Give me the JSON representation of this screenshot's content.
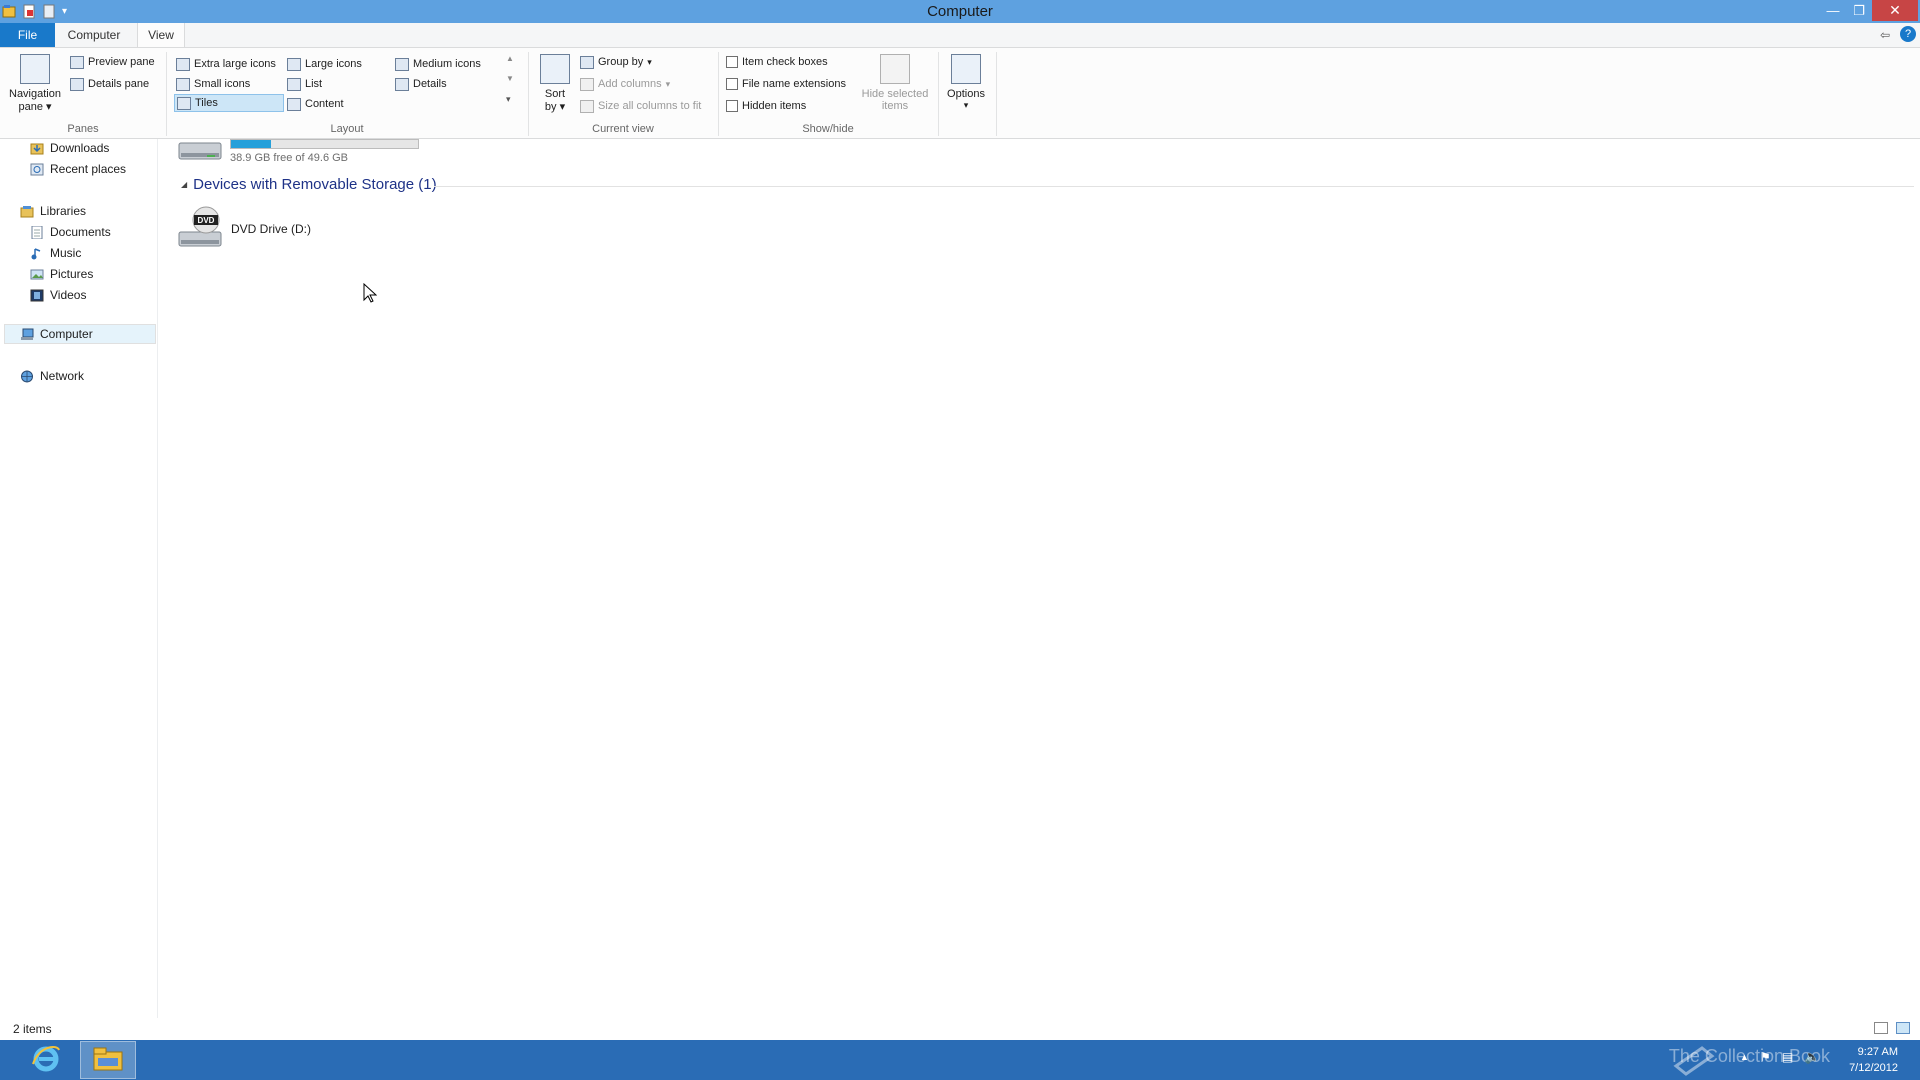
{
  "window": {
    "title": "Computer"
  },
  "ribbon": {
    "tabs": [
      {
        "label": "File"
      },
      {
        "label": "Computer"
      },
      {
        "label": "View"
      }
    ],
    "panes": {
      "navigation_pane": "Navigation",
      "navigation_pane_line2": "pane",
      "preview_pane": "Preview pane",
      "details_pane": "Details pane",
      "group_label": "Panes"
    },
    "layout": {
      "items": [
        "Extra large icons",
        "Large icons",
        "Medium icons",
        "Small icons",
        "List",
        "Details",
        "Tiles",
        "Content"
      ],
      "selected": "Tiles",
      "group_label": "Layout"
    },
    "current_view": {
      "sort_by": "Sort",
      "sort_by_line2": "by",
      "group_by": "Group by",
      "add_columns": "Add columns",
      "size_all_columns": "Size all columns to fit",
      "group_label": "Current view"
    },
    "show_hide": {
      "item_check_boxes": "Item check boxes",
      "file_name_extensions": "File name extensions",
      "hidden_items": "Hidden items",
      "hide_selected": "Hide selected",
      "hide_selected_line2": "items",
      "group_label": "Show/hide"
    },
    "options": {
      "label": "Options"
    }
  },
  "nav": {
    "items": [
      {
        "label": "Downloads",
        "icon": "downloads-icon"
      },
      {
        "label": "Recent places",
        "icon": "recent-places-icon"
      },
      {
        "label": "Libraries",
        "icon": "libraries-icon"
      },
      {
        "label": "Documents",
        "icon": "documents-icon"
      },
      {
        "label": "Music",
        "icon": "music-icon"
      },
      {
        "label": "Pictures",
        "icon": "pictures-icon"
      },
      {
        "label": "Videos",
        "icon": "videos-icon"
      },
      {
        "label": "Computer",
        "icon": "computer-icon"
      },
      {
        "label": "Network",
        "icon": "network-icon"
      }
    ]
  },
  "content": {
    "local_drive": {
      "free_text": "38.9 GB free of 49.6 GB",
      "used_fraction": 0.216
    },
    "removable_group": {
      "title": "Devices with Removable Storage (1)"
    },
    "dvd_drive": {
      "label": "DVD Drive (D:)",
      "badge": "DVD"
    }
  },
  "status_bar": {
    "item_count": "2 items"
  },
  "taskbar": {
    "time": "9:27 AM",
    "date": "7/12/2012",
    "watermark": "The Collection Book"
  },
  "colors": {
    "title_bar": "#5ea1e0",
    "file_tab": "#1979ca",
    "taskbar": "#2a6cb5",
    "group_heading": "#1e3287",
    "progress_fill": "#26a0da"
  }
}
